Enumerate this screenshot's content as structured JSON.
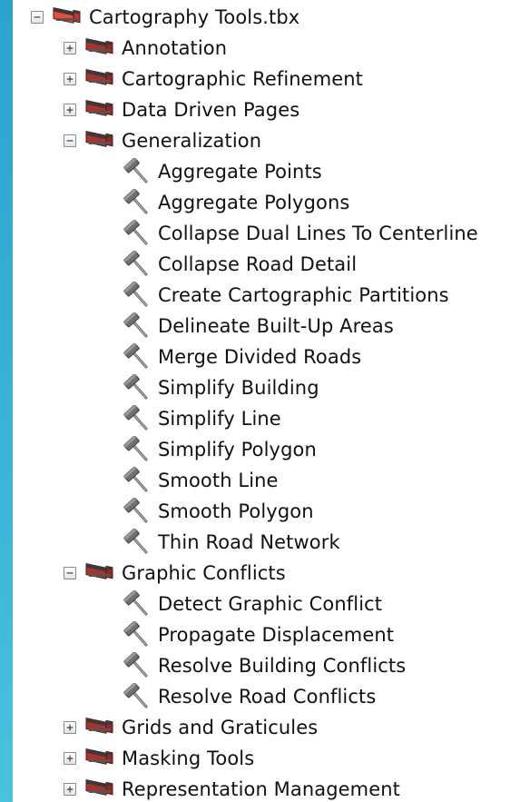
{
  "tree": {
    "root": {
      "label": "Cartography Tools.tbx",
      "expanded": true,
      "icon": "toolbox-red-icon"
    },
    "toolsets": [
      {
        "label": "Annotation",
        "expanded": false,
        "icon": "toolset-icon",
        "tools": []
      },
      {
        "label": "Cartographic Refinement",
        "expanded": false,
        "icon": "toolset-icon",
        "tools": []
      },
      {
        "label": "Data Driven Pages",
        "expanded": false,
        "icon": "toolset-icon",
        "tools": []
      },
      {
        "label": "Generalization",
        "expanded": true,
        "icon": "toolset-icon",
        "tools": [
          "Aggregate Points",
          "Aggregate Polygons",
          "Collapse Dual Lines To Centerline",
          "Collapse Road Detail",
          "Create Cartographic Partitions",
          "Delineate Built-Up Areas",
          "Merge Divided Roads",
          "Simplify Building",
          "Simplify Line",
          "Simplify Polygon",
          "Smooth Line",
          "Smooth Polygon",
          "Thin Road Network"
        ]
      },
      {
        "label": "Graphic Conflicts",
        "expanded": true,
        "icon": "toolset-icon",
        "tools": [
          "Detect Graphic Conflict",
          "Propagate Displacement",
          "Resolve Building Conflicts",
          "Resolve Road Conflicts"
        ]
      },
      {
        "label": "Grids and Graticules",
        "expanded": false,
        "icon": "toolset-icon",
        "tools": []
      },
      {
        "label": "Masking Tools",
        "expanded": false,
        "icon": "toolset-icon",
        "tools": []
      },
      {
        "label": "Representation Management",
        "expanded": false,
        "icon": "toolset-icon",
        "tools": []
      }
    ],
    "tool_icon": "hammer-icon",
    "expand_glyph": "+",
    "collapse_glyph": "−"
  }
}
